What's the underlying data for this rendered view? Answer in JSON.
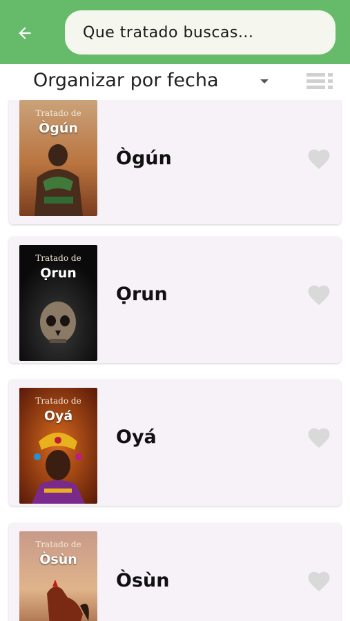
{
  "search": {
    "placeholder": "Que tratado buscas..."
  },
  "sort": {
    "label": "Organizar por fecha"
  },
  "colors": {
    "appbar": "#66bb6a",
    "card": "#f7f2f8",
    "heart": "#d9d9d9"
  },
  "items": [
    {
      "cover_top": "Tratado de",
      "cover_name": "Ògún",
      "title": "Ògún"
    },
    {
      "cover_top": "Tratado de",
      "cover_name": "Ọrun",
      "title": "Ọrun"
    },
    {
      "cover_top": "Tratado de",
      "cover_name": "Oyá",
      "title": "Oyá"
    },
    {
      "cover_top": "Tratado de",
      "cover_name": "Òsùn",
      "title": "Òsùn"
    }
  ]
}
